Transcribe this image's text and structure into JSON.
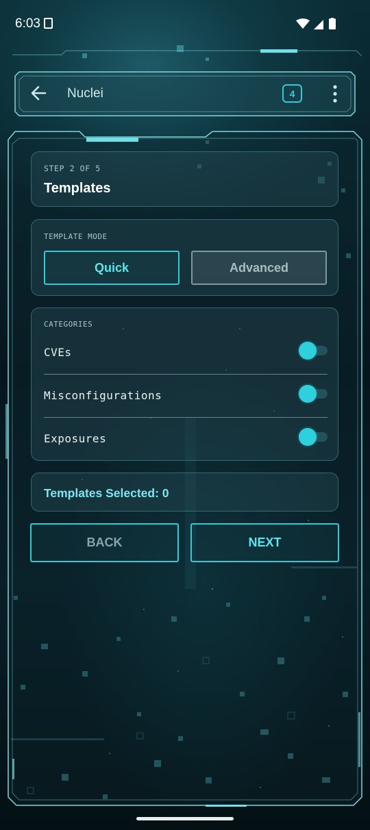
{
  "status_bar": {
    "time": "6:03"
  },
  "app_bar": {
    "title": "Nuclei",
    "badge_count": "4"
  },
  "step_card": {
    "step_label": "STEP 2 OF 5",
    "title": "Templates"
  },
  "template_mode": {
    "label": "TEMPLATE MODE",
    "options": [
      {
        "label": "Quick",
        "selected": true
      },
      {
        "label": "Advanced",
        "selected": false
      }
    ]
  },
  "categories": {
    "label": "CATEGORIES",
    "items": [
      {
        "name": "CVEs",
        "enabled": true
      },
      {
        "name": "Misconfigurations",
        "enabled": true
      },
      {
        "name": "Exposures",
        "enabled": true
      }
    ]
  },
  "summary": {
    "selected_text": "Templates Selected: 0"
  },
  "navigation": {
    "back_label": "BACK",
    "next_label": "NEXT"
  },
  "colors": {
    "accent": "#36c9d6",
    "toggle_on": "#2ed0dc",
    "panel_frame": "#7fd6de",
    "background": "#06161d"
  },
  "icons": {
    "back": "arrow-left-icon",
    "more": "more-vertical-icon",
    "sim": "sim-card-icon",
    "wifi": "wifi-icon",
    "signal": "cell-signal-icon",
    "battery": "battery-icon"
  }
}
